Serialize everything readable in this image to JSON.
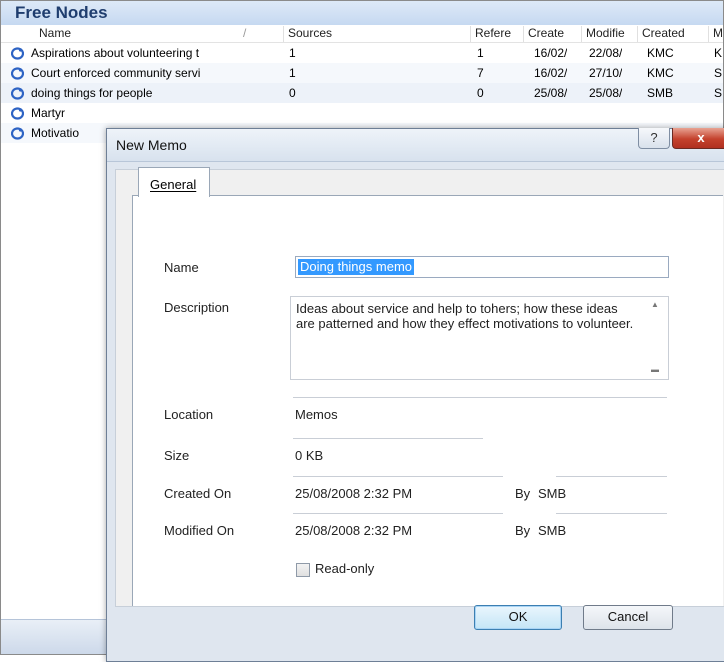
{
  "panel": {
    "title": "Free Nodes"
  },
  "columns": [
    "Name",
    "Sources",
    "Refere",
    "Create",
    "Modifie",
    "Created",
    "M"
  ],
  "rows": [
    {
      "name": "Aspirations about volunteering t",
      "sources": "1",
      "refs": "1",
      "created": "16/02/",
      "modified": "22/08/",
      "created_by": "KMC",
      "mod_by": "K"
    },
    {
      "name": "Court enforced community servi",
      "sources": "1",
      "refs": "7",
      "created": "16/02/",
      "modified": "27/10/",
      "created_by": "KMC",
      "mod_by": "S"
    },
    {
      "name": "doing things for people",
      "sources": "0",
      "refs": "0",
      "created": "25/08/",
      "modified": "25/08/",
      "created_by": "SMB",
      "mod_by": "S"
    },
    {
      "name": "Martyr"
    },
    {
      "name": "Motivatio"
    }
  ],
  "dialog": {
    "title": "New Memo",
    "help_glyph": "?",
    "close_glyph": "x",
    "tab_label": "General",
    "fields": {
      "name_label": "Name",
      "name_value": "Doing things memo",
      "description_label": "Description",
      "description_value": "Ideas about service and help to tohers; how these ideas are patterned and how they effect motivations to volunteer.",
      "location_label": "Location",
      "location_value": "Memos",
      "size_label": "Size",
      "size_value": "0 KB",
      "created_on_label": "Created On",
      "created_on_value": "25/08/2008 2:32 PM",
      "created_by_label": "By",
      "created_by_value": "SMB",
      "modified_on_label": "Modified On",
      "modified_on_value": "25/08/2008 2:32 PM",
      "modified_by_label": "By",
      "modified_by_value": "SMB",
      "readonly_label": "Read-only",
      "readonly_checked": false
    },
    "ok_label": "OK",
    "cancel_label": "Cancel"
  },
  "colors": {
    "node_icon": "#2d63c4",
    "selection": "#3399ff",
    "close_button": "#c4422d"
  }
}
